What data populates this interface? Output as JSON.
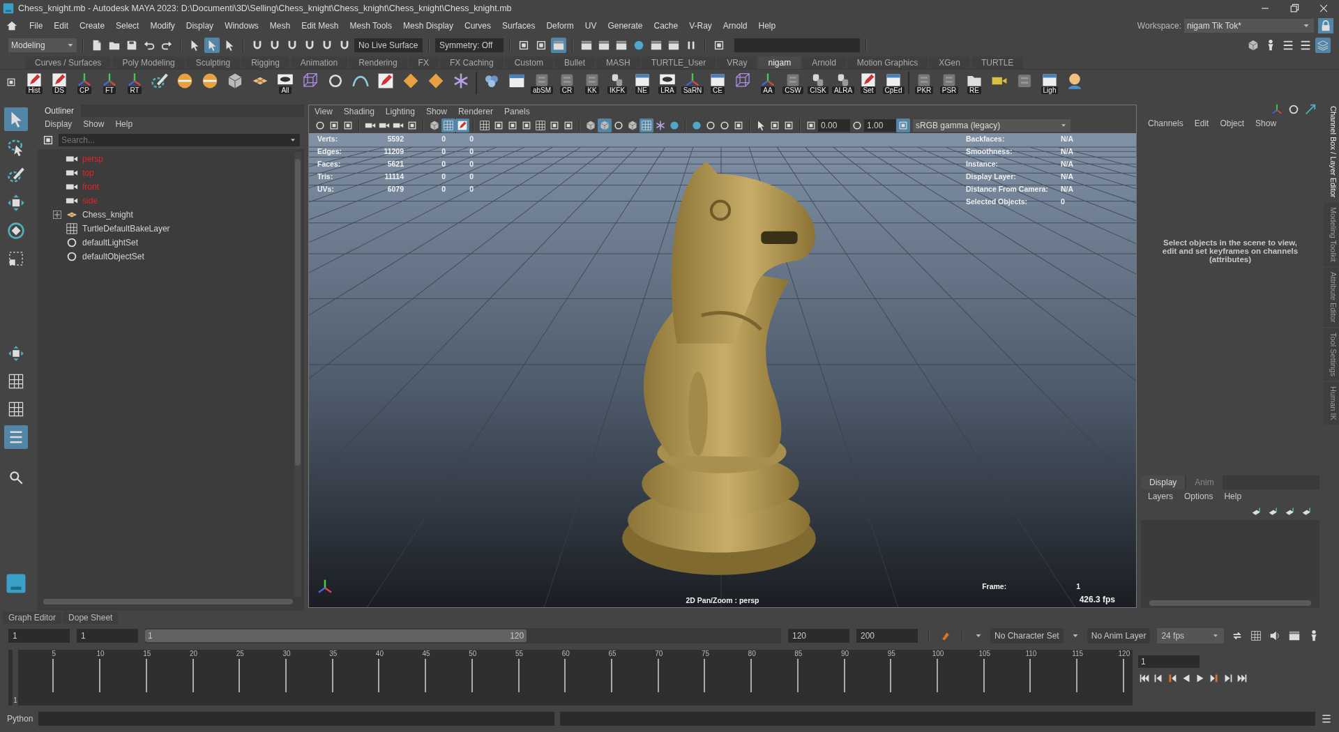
{
  "window": {
    "title": "Chess_knight.mb - Autodesk MAYA 2023: D:\\Documenti\\3D\\Selling\\Chess_knight\\Chess_knight\\Chess_knight\\Chess_knight.mb"
  },
  "menu_bar": {
    "items": [
      "File",
      "Edit",
      "Create",
      "Select",
      "Modify",
      "Display",
      "Windows",
      "Mesh",
      "Edit Mesh",
      "Mesh Tools",
      "Mesh Display",
      "Curves",
      "Surfaces",
      "Deform",
      "UV",
      "Generate",
      "Cache",
      "V-Ray",
      "Arnold",
      "Help"
    ],
    "workspace_label": "Workspace:",
    "workspace": "nigam Tik Tok*"
  },
  "status_line": {
    "left": [
      {
        "kind": "dropdown",
        "value": "Modeling"
      },
      {
        "kind": "separator"
      },
      {
        "kind": "button",
        "selected": false
      },
      {
        "kind": "button",
        "selected": false
      },
      {
        "kind": "button",
        "selected": false
      },
      {
        "kind": "button",
        "selected": false
      },
      {
        "kind": "button",
        "selected": false
      },
      {
        "kind": "separator"
      },
      {
        "kind": "button",
        "selected": false
      },
      {
        "kind": "button",
        "selected": true
      },
      {
        "kind": "button",
        "selected": false
      },
      {
        "kind": "separator"
      },
      {
        "kind": "button",
        "selected": false
      },
      {
        "kind": "button",
        "selected": false
      },
      {
        "kind": "button",
        "selected": false
      },
      {
        "kind": "button",
        "selected": false
      },
      {
        "kind": "button",
        "selected": false
      },
      {
        "kind": "button",
        "selected": false
      },
      {
        "kind": "field",
        "value": "No Live Surface"
      },
      {
        "kind": "separator"
      },
      {
        "kind": "field",
        "value": "Symmetry: Off"
      },
      {
        "kind": "separator"
      },
      {
        "kind": "button",
        "selected": false
      },
      {
        "kind": "button",
        "selected": false
      },
      {
        "kind": "button",
        "selected": true
      },
      {
        "kind": "separator"
      },
      {
        "kind": "button",
        "selected": false
      },
      {
        "kind": "button",
        "selected": false
      },
      {
        "kind": "button",
        "selected": false
      },
      {
        "kind": "button",
        "selected": false
      },
      {
        "kind": "button",
        "selected": false
      },
      {
        "kind": "button",
        "selected": false
      },
      {
        "kind": "button",
        "selected": false
      },
      {
        "kind": "separator"
      },
      {
        "kind": "button",
        "selected": false
      },
      {
        "kind": "input"
      },
      {
        "kind": "separator"
      }
    ],
    "right": [
      {
        "kind": "button",
        "selected": false
      },
      {
        "kind": "button",
        "selected": false
      },
      {
        "kind": "button",
        "selected": false
      },
      {
        "kind": "button",
        "selected": false
      },
      {
        "kind": "button",
        "selected": true
      }
    ]
  },
  "shelf_tabs": [
    {
      "label": "Curves / Surfaces",
      "selected": false
    },
    {
      "label": "Poly Modeling",
      "selected": false
    },
    {
      "label": "Sculpting",
      "selected": false
    },
    {
      "label": "Rigging",
      "selected": false
    },
    {
      "label": "Animation",
      "selected": false
    },
    {
      "label": "Rendering",
      "selected": false
    },
    {
      "label": "FX",
      "selected": false
    },
    {
      "label": "FX Caching",
      "selected": false
    },
    {
      "label": "Custom",
      "selected": false
    },
    {
      "label": "Bullet",
      "selected": false
    },
    {
      "label": "MASH",
      "selected": false
    },
    {
      "label": "TURTLE_User",
      "selected": false
    },
    {
      "label": "VRay",
      "selected": false
    },
    {
      "label": "nigam",
      "selected": true
    },
    {
      "label": "Arnold",
      "selected": false
    },
    {
      "label": "Motion Graphics",
      "selected": false
    },
    {
      "label": "XGen",
      "selected": false
    },
    {
      "label": "TURTLE",
      "selected": false
    }
  ],
  "shelf": [
    {
      "kind": "labeled",
      "label": "Hist"
    },
    {
      "kind": "labeled",
      "label": "DS"
    },
    {
      "kind": "labeled",
      "label": "CP"
    },
    {
      "kind": "labeled",
      "label": "FT"
    },
    {
      "kind": "labeled",
      "label": "RT"
    },
    {
      "kind": "plain"
    },
    {
      "kind": "plain"
    },
    {
      "kind": "plain"
    },
    {
      "kind": "plain"
    },
    {
      "kind": "plain"
    },
    {
      "kind": "labeled",
      "label": "All"
    },
    {
      "kind": "plain"
    },
    {
      "kind": "plain"
    },
    {
      "kind": "plain"
    },
    {
      "kind": "plain"
    },
    {
      "kind": "plain"
    },
    {
      "kind": "plain"
    },
    {
      "kind": "plain"
    },
    {
      "kind": "separator"
    },
    {
      "kind": "plain"
    },
    {
      "kind": "plain"
    },
    {
      "kind": "labeled",
      "label": "abSM"
    },
    {
      "kind": "labeled",
      "label": "CR"
    },
    {
      "kind": "labeled",
      "label": "KK"
    },
    {
      "kind": "labeled",
      "label": "IKFK"
    },
    {
      "kind": "labeled",
      "label": "NE"
    },
    {
      "kind": "labeled",
      "label": "LRA"
    },
    {
      "kind": "labeled",
      "label": "SaRN"
    },
    {
      "kind": "labeled",
      "label": "CE"
    },
    {
      "kind": "plain"
    },
    {
      "kind": "labeled",
      "label": "AA"
    },
    {
      "kind": "labeled",
      "label": "CSW"
    },
    {
      "kind": "labeled",
      "label": "CISK"
    },
    {
      "kind": "labeled",
      "label": "ALRA"
    },
    {
      "kind": "labeled",
      "label": "Set"
    },
    {
      "kind": "labeled",
      "label": "CpEd"
    },
    {
      "kind": "separator"
    },
    {
      "kind": "labeled",
      "label": "PKR"
    },
    {
      "kind": "labeled",
      "label": "PSR"
    },
    {
      "kind": "labeled",
      "label": "RE"
    },
    {
      "kind": "plain"
    },
    {
      "kind": "plain"
    },
    {
      "kind": "labeled",
      "label": "Ligh"
    },
    {
      "kind": "plain"
    }
  ],
  "toolbox": {
    "tools": [
      {
        "selected": true
      },
      {
        "selected": false
      },
      {
        "selected": false
      },
      {
        "selected": false
      },
      {
        "selected": false
      },
      {
        "selected": false
      }
    ],
    "layouts": [
      {
        "selected": false
      },
      {
        "selected": false
      },
      {
        "selected": false
      },
      {
        "selected": true
      }
    ]
  },
  "outliner": {
    "tab": "Outliner",
    "menus": [
      "Display",
      "Show",
      "Help"
    ],
    "search": {
      "placeholder": "Search..."
    },
    "items": [
      {
        "kind": "camera",
        "name": "persp",
        "color": "#e0242a"
      },
      {
        "kind": "camera",
        "name": "top",
        "color": "#e0242a"
      },
      {
        "kind": "camera",
        "name": "front",
        "color": "#e0242a"
      },
      {
        "kind": "camera",
        "name": "side",
        "color": "#e0242a"
      },
      {
        "kind": "group",
        "name": "Chess_knight",
        "color": "#d4d4d4",
        "expanded": false
      },
      {
        "kind": "layer",
        "name": "TurtleDefaultBakeLayer",
        "color": "#d4d4d4"
      },
      {
        "kind": "set",
        "name": "defaultLightSet",
        "color": "#d4d4d4"
      },
      {
        "kind": "set",
        "name": "defaultObjectSet",
        "color": "#d4d4d4"
      }
    ]
  },
  "viewport": {
    "menus": [
      "View",
      "Shading",
      "Lighting",
      "Show",
      "Renderer",
      "Panels"
    ],
    "toolbar": [
      {
        "kind": "button",
        "selected": false
      },
      {
        "kind": "button",
        "selected": false
      },
      {
        "kind": "button",
        "selected": false
      },
      {
        "kind": "separator"
      },
      {
        "kind": "button",
        "selected": false
      },
      {
        "kind": "button",
        "selected": false
      },
      {
        "kind": "button",
        "selected": false
      },
      {
        "kind": "button",
        "selected": false
      },
      {
        "kind": "separator"
      },
      {
        "kind": "button",
        "selected": false
      },
      {
        "kind": "button",
        "selected": true
      },
      {
        "kind": "button",
        "selected": true
      },
      {
        "kind": "separator"
      },
      {
        "kind": "button",
        "selected": false
      },
      {
        "kind": "button",
        "selected": false
      },
      {
        "kind": "button",
        "selected": false
      },
      {
        "kind": "button",
        "selected": false
      },
      {
        "kind": "button",
        "selected": false
      },
      {
        "kind": "button",
        "selected": false
      },
      {
        "kind": "button",
        "selected": false
      },
      {
        "kind": "separator"
      },
      {
        "kind": "button",
        "selected": false
      },
      {
        "kind": "button",
        "selected": true
      },
      {
        "kind": "button",
        "selected": false
      },
      {
        "kind": "button",
        "selected": false
      },
      {
        "kind": "button",
        "selected": true
      },
      {
        "kind": "button",
        "selected": false
      },
      {
        "kind": "button",
        "selected": false
      },
      {
        "kind": "separator"
      },
      {
        "kind": "button",
        "selected": false
      },
      {
        "kind": "button",
        "selected": false
      },
      {
        "kind": "button",
        "selected": false
      },
      {
        "kind": "button",
        "selected": false
      },
      {
        "kind": "separator"
      },
      {
        "kind": "button",
        "selected": false
      },
      {
        "kind": "button",
        "selected": false
      },
      {
        "kind": "button",
        "selected": false
      },
      {
        "kind": "separator"
      },
      {
        "kind": "button",
        "selected": false
      },
      {
        "kind": "field",
        "value": "0.00"
      },
      {
        "kind": "button",
        "selected": false
      },
      {
        "kind": "field",
        "value": "1.00"
      },
      {
        "kind": "button",
        "selected": true
      },
      {
        "kind": "dropdown",
        "value": "sRGB gamma (legacy)"
      }
    ],
    "stats": [
      {
        "label": "Verts:",
        "values": [
          "5592",
          "0",
          "0"
        ]
      },
      {
        "label": "Edges:",
        "values": [
          "11209",
          "0",
          "0"
        ]
      },
      {
        "label": "Faces:",
        "values": [
          "5621",
          "0",
          "0"
        ]
      },
      {
        "label": "Tris:",
        "values": [
          "11114",
          "0",
          "0"
        ]
      },
      {
        "label": "UVs:",
        "values": [
          "6079",
          "0",
          "0"
        ]
      }
    ],
    "info": [
      {
        "label": "Backfaces:",
        "value": "N/A"
      },
      {
        "label": "Smoothness:",
        "value": "N/A"
      },
      {
        "label": "Instance:",
        "value": "N/A"
      },
      {
        "label": "Display Layer:",
        "value": "N/A"
      },
      {
        "label": "Distance From Camera:",
        "value": "N/A"
      },
      {
        "label": "Selected Objects:",
        "value": "0"
      }
    ],
    "camera": "2D Pan/Zoom : persp",
    "frame_label": "Frame:",
    "frame": "1",
    "fps": "426.3 fps"
  },
  "channel_box": {
    "menus": [
      "Channels",
      "Edit",
      "Object",
      "Show"
    ],
    "message": "Select objects in the scene to view, edit and set keyframes on channels (attributes)"
  },
  "layer_editor": {
    "tabs": [
      {
        "label": "Display",
        "selected": true
      },
      {
        "label": "Anim",
        "selected": false
      }
    ],
    "menus": [
      "Layers",
      "Options",
      "Help"
    ]
  },
  "side_tabs": [
    {
      "label": "Channel Box / Layer Editor",
      "selected": true
    },
    {
      "label": "Modeling Toolkit",
      "selected": false
    },
    {
      "label": "Attribute Editor",
      "selected": false
    },
    {
      "label": "Tool Settings",
      "selected": false
    },
    {
      "label": "Human IK",
      "selected": false
    }
  ],
  "bottom_tabs": [
    "Graph Editor",
    "Dope Sheet"
  ],
  "range": {
    "start": "1",
    "playback_start": "1",
    "bar_start": "1",
    "bar_end": "120",
    "level": 0.6,
    "playback_end": "120",
    "end": "200",
    "character_set": "No Character Set",
    "anim_layer": "No Anim Layer",
    "fps": "24 fps"
  },
  "time_slider": {
    "ticks": [
      "5",
      "10",
      "15",
      "20",
      "25",
      "30",
      "35",
      "40",
      "45",
      "50",
      "55",
      "60",
      "65",
      "70",
      "75",
      "80",
      "85",
      "90",
      "95",
      "100",
      "105",
      "110",
      "115",
      "120"
    ],
    "current": "1",
    "level": 0,
    "current_field": "1"
  },
  "command_line": {
    "language": "Python"
  }
}
